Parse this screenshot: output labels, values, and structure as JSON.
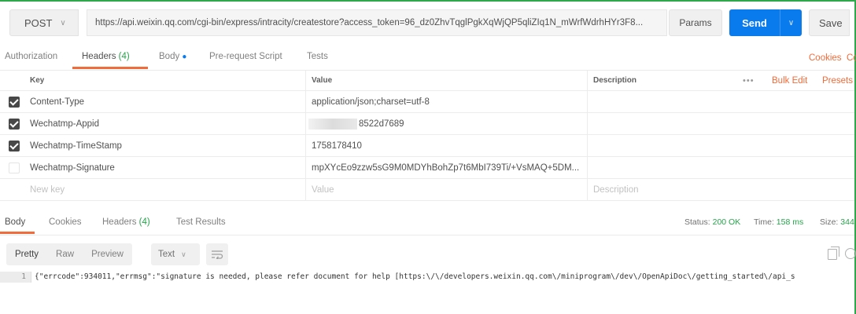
{
  "request": {
    "method": "POST",
    "url": "https://api.weixin.qq.com/cgi-bin/express/intracity/createstore?access_token=96_dz0ZhvTqglPgkXqWjQP5qliZIq1N_mWrfWdrhHYr3F8...",
    "params_label": "Params",
    "send_label": "Send",
    "save_label": "Save"
  },
  "request_tabs": {
    "authorization": "Authorization",
    "headers": "Headers",
    "headers_count": "(4)",
    "body": "Body",
    "body_dot": "●",
    "prerequest": "Pre-request Script",
    "tests": "Tests",
    "cookies": "Cookies",
    "code": "Co"
  },
  "headers_table": {
    "col_key": "Key",
    "col_value": "Value",
    "col_description": "Description",
    "dots": "•••",
    "bulk_edit": "Bulk Edit",
    "presets": "Presets",
    "rows": [
      {
        "checked": true,
        "key": "Content-Type",
        "value": "application/json;charset=utf-8",
        "blurred": false
      },
      {
        "checked": true,
        "key": "Wechatmp-Appid",
        "value": "8522d7689",
        "blurred": true
      },
      {
        "checked": true,
        "key": "Wechatmp-TimeStamp",
        "value": "1758178410",
        "blurred": false
      },
      {
        "checked": false,
        "key": "Wechatmp-Signature",
        "value": "mpXYcEo9zzw5sG9M0MDYhBohZp7t6MbI739Ti/+VsMAQ+5DM...",
        "blurred": false
      }
    ],
    "new_key_placeholder": "New key",
    "new_value_placeholder": "Value",
    "new_description_placeholder": "Description"
  },
  "response_tabs": {
    "body": "Body",
    "cookies": "Cookies",
    "headers": "Headers",
    "headers_count": "(4)",
    "test_results": "Test Results",
    "status_label": "Status:",
    "status_value": "200 OK",
    "time_label": "Time:",
    "time_value": "158 ms",
    "size_label": "Size:",
    "size_value": "344"
  },
  "response_toolbar": {
    "pretty": "Pretty",
    "raw": "Raw",
    "preview": "Preview",
    "format": "Text"
  },
  "response_body": {
    "line_number": "1",
    "text": "{\"errcode\":934011,\"errmsg\":\"signature is needed, please refer document for help [https:\\/\\/developers.weixin.qq.com\\/miniprogram\\/dev\\/OpenApiDoc\\/getting_started\\/api_s"
  },
  "colors": {
    "accent_orange": "#f26b3a",
    "send_blue": "#097bed",
    "status_green": "#26a44a"
  }
}
